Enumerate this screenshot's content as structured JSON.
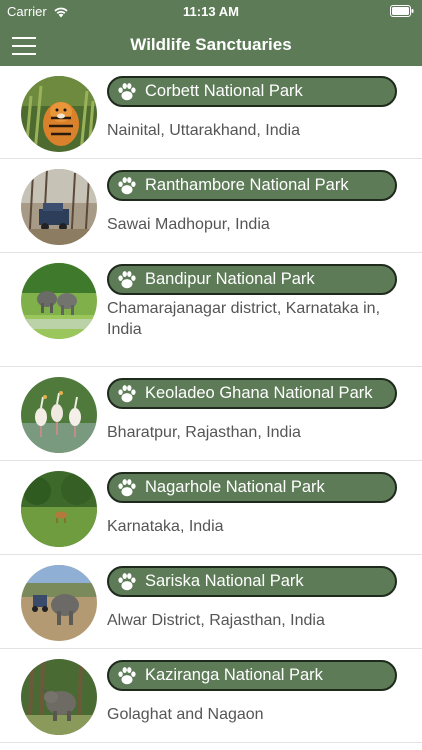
{
  "status_bar": {
    "carrier": "Carrier",
    "time": "11:13 AM",
    "icons": [
      "wifi-icon",
      "battery-icon"
    ]
  },
  "nav": {
    "title": "Wildlife Sanctuaries",
    "menu_icon": "hamburger-menu-icon"
  },
  "colors": {
    "brand_green": "#5d7b57",
    "pill_border": "#1e2a1c",
    "location_text": "#555555"
  },
  "parks": [
    {
      "name": "Corbett National Park",
      "location": "Nainital, Uttarakhand, India",
      "thumb": "tiger-in-grass"
    },
    {
      "name": "Ranthambore National Park",
      "location": "Sawai Madhopur, India",
      "thumb": "safari-jeep-forest"
    },
    {
      "name": "Bandipur National Park",
      "location": "Chamarajanagar district, Karnataka in, India",
      "thumb": "elephants-grassland"
    },
    {
      "name": "Keoladeo Ghana National Park",
      "location": "Bharatpur, Rajasthan, India",
      "thumb": "storks-wetland"
    },
    {
      "name": "Nagarhole National Park",
      "location": "Karnataka, India",
      "thumb": "deer-forest-clearing"
    },
    {
      "name": "Sariska National Park",
      "location": "Alwar District, Rajasthan, India",
      "thumb": "elephant-jeep-trail"
    },
    {
      "name": "Kaziranga National Park",
      "location": "Golaghat and Nagaon",
      "thumb": "rhino-forest"
    }
  ]
}
